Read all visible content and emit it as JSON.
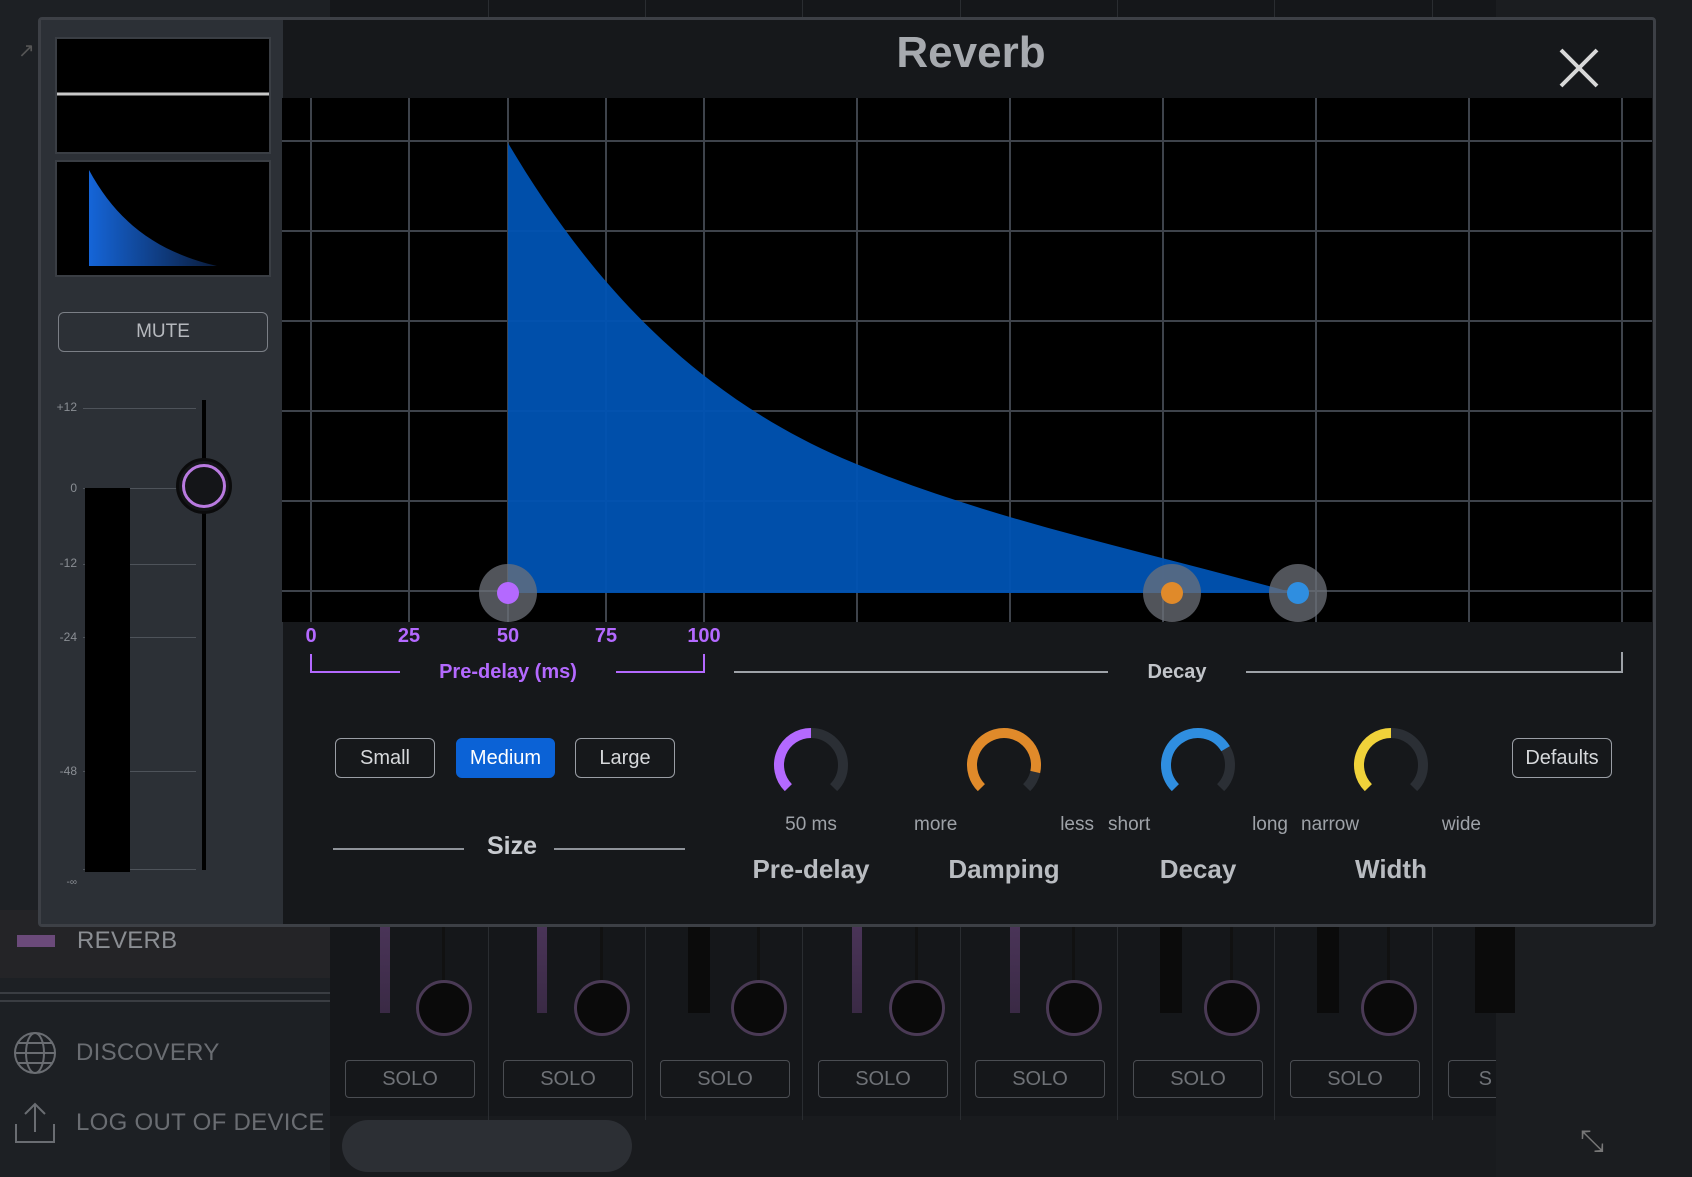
{
  "background": {
    "sidebar": {
      "reverb_label": "REVERB",
      "discovery_label": "DISCOVERY",
      "logout_label": "LOG OUT OF DEVICE"
    },
    "channel_strips": [
      {
        "solo_label": "SOLO"
      },
      {
        "solo_label": "SOLO"
      },
      {
        "solo_label": "SOLO"
      },
      {
        "solo_label": "SOLO"
      },
      {
        "solo_label": "SOLO"
      },
      {
        "solo_label": "SOLO"
      },
      {
        "solo_label": "SOLO"
      },
      {
        "solo_label": "S"
      }
    ]
  },
  "modal": {
    "title": "Reverb",
    "mute_label": "MUTE",
    "fader_scale": [
      "+12",
      "0",
      "-12",
      "-24",
      "-48",
      "-∞"
    ],
    "graph": {
      "predelay_ticks": [
        "0",
        "25",
        "50",
        "75",
        "100"
      ],
      "predelay_label": "Pre-delay (ms)",
      "decay_label": "Decay",
      "colors": {
        "fill": "#0053b3",
        "predelay_accent": "#b469ff",
        "damping_handle": "#e08a2a",
        "decay_handle": "#2f8ee0"
      }
    },
    "size": {
      "label": "Size",
      "options": [
        "Small",
        "Medium",
        "Large"
      ],
      "selected": "Medium"
    },
    "knobs": {
      "predelay": {
        "title": "Pre-delay",
        "value_text": "50 ms",
        "color": "#b469ff",
        "level": 0.5
      },
      "damping": {
        "title": "Damping",
        "left": "more",
        "right": "less",
        "color": "#e08a2a",
        "level": 0.88
      },
      "decay": {
        "title": "Decay",
        "left": "short",
        "right": "long",
        "color": "#2f8ee0",
        "level": 0.72
      },
      "width": {
        "title": "Width",
        "left": "narrow",
        "right": "wide",
        "color": "#f0d23a",
        "level": 0.5
      }
    },
    "defaults_label": "Defaults"
  }
}
